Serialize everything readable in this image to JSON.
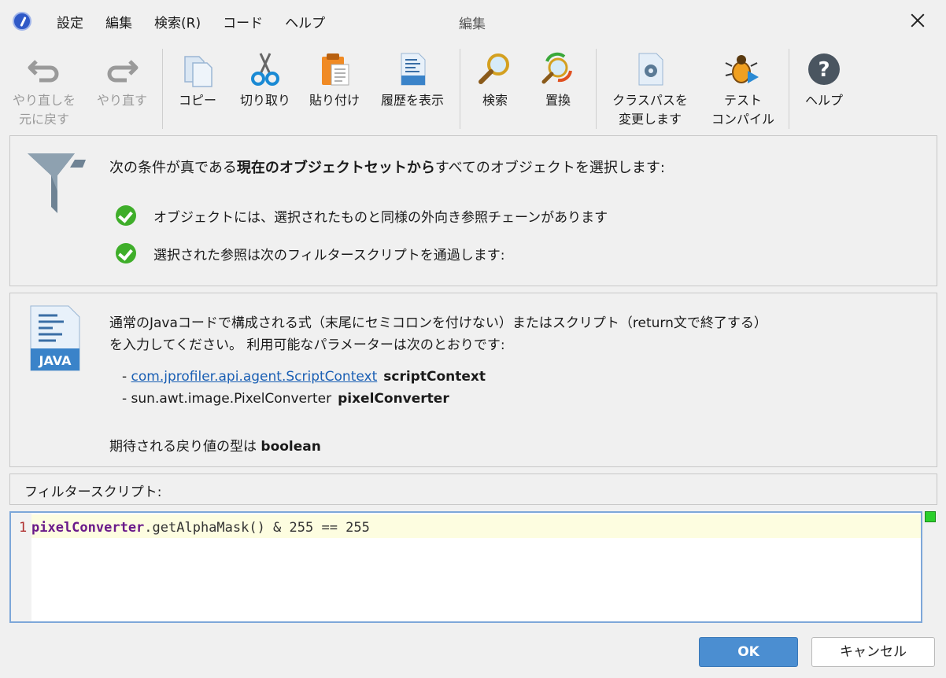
{
  "window": {
    "title": "編集",
    "menu": [
      "設定",
      "編集",
      "検索(R)",
      "コード",
      "ヘルプ"
    ]
  },
  "toolbar": {
    "undo": [
      "やり直しを",
      "元に戻す"
    ],
    "redo": "やり直す",
    "copy": "コピー",
    "cut": "切り取り",
    "paste": "貼り付け",
    "history": "履歴を表示",
    "find": "検索",
    "replace": "置換",
    "classpath": [
      "クラスパスを",
      "変更します"
    ],
    "compile": [
      "テスト",
      "コンパイル"
    ],
    "help": "ヘルプ",
    "java_badge": "JAVA"
  },
  "selection": {
    "headline_pre": "次の条件が真である",
    "headline_bold": "現在のオブジェクトセットから",
    "headline_post": "すべてのオブジェクトを選択します:",
    "conditions": [
      "オブジェクトには、選択されたものと同様の外向き参照チェーンがあります",
      "選択された参照は次のフィルタースクリプトを通過します:"
    ]
  },
  "script_info": {
    "java_badge": "JAVA",
    "description_line1": "通常のJavaコードで構成される式（末尾にセミコロンを付けない）またはスクリプト（return文で終了する）",
    "description_line2": "を入力してください。 利用可能なパラメーターは次のとおりです:",
    "params": [
      {
        "dash": "- ",
        "type": "com.jprofiler.api.agent.ScriptContext",
        "name": "scriptContext",
        "link": true
      },
      {
        "dash": "- ",
        "type": "sun.awt.image.PixelConverter",
        "name": "pixelConverter",
        "link": false
      }
    ],
    "return_pre": "期待される戻り値の型は ",
    "return_type": "boolean"
  },
  "filter_label": "フィルタースクリプト:",
  "editor": {
    "line_number": "1",
    "code_keyword": "pixelConverter",
    "code_rest": ".getAlphaMask() & 255 == 255"
  },
  "buttons": {
    "ok": "OK",
    "cancel": "キャンセル"
  }
}
